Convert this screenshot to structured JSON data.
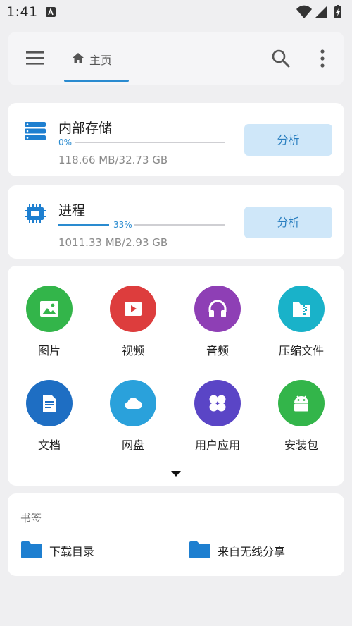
{
  "status_bar": {
    "time": "1:41"
  },
  "header": {
    "menu_icon": "menu-icon",
    "home_tab_label": "主页",
    "search_icon": "search-icon",
    "more_icon": "more-vert-icon",
    "accent_color": "#2a8bd0"
  },
  "storage": [
    {
      "title": "内部存储",
      "percent_label": "0%",
      "percent": 0,
      "size": "118.66 MB/32.73 GB",
      "button": "分析",
      "icon": "storage-icon"
    },
    {
      "title": "进程",
      "percent_label": "33%",
      "percent": 33,
      "size": "1011.33 MB/2.93 GB",
      "button": "分析",
      "icon": "memory-chip-icon"
    }
  ],
  "categories": [
    {
      "label": "图片",
      "icon": "image-icon",
      "color": "#33b54a"
    },
    {
      "label": "视频",
      "icon": "video-icon",
      "color": "#dd3d3d"
    },
    {
      "label": "音频",
      "icon": "headphones-icon",
      "color": "#8e3fb5"
    },
    {
      "label": "压缩文件",
      "icon": "archive-icon",
      "color": "#19b2c9"
    },
    {
      "label": "文档",
      "icon": "document-icon",
      "color": "#1e6ec3"
    },
    {
      "label": "网盘",
      "icon": "cloud-icon",
      "color": "#2aa1db"
    },
    {
      "label": "用户应用",
      "icon": "apps-icon",
      "color": "#5a45c6"
    },
    {
      "label": "安装包",
      "icon": "android-icon",
      "color": "#33b54a"
    }
  ],
  "bookmarks": {
    "header": "书签",
    "items": [
      {
        "label": "下载目录",
        "icon": "folder-icon"
      },
      {
        "label": "来自无线分享",
        "icon": "folder-icon"
      }
    ],
    "folder_color": "#1e7fd0"
  }
}
